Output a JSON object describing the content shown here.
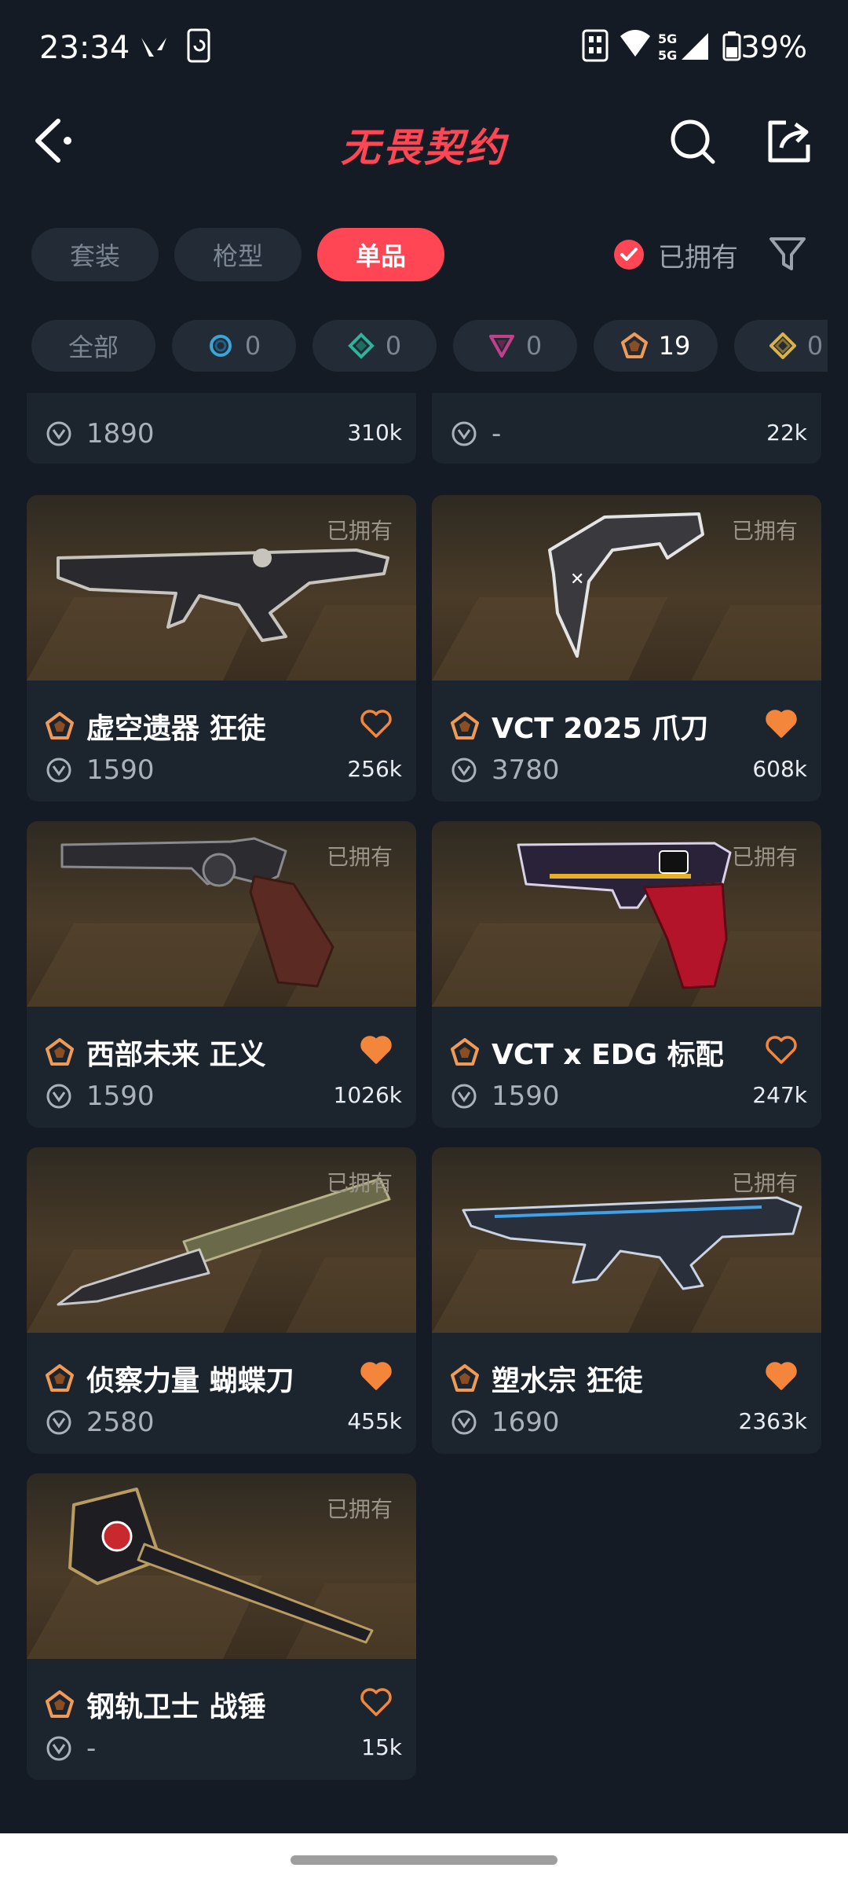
{
  "status_bar": {
    "time": "23:34",
    "network": "5G",
    "battery": "39%"
  },
  "header": {
    "title": "无畏契约"
  },
  "tabs": [
    {
      "label": "套装",
      "active": false
    },
    {
      "label": "枪型",
      "active": false
    },
    {
      "label": "单品",
      "active": true
    }
  ],
  "owned_filter": {
    "label": "已拥有",
    "checked": true
  },
  "rarity_chips": [
    {
      "label": "全部"
    },
    {
      "count": "0",
      "icon": "select-tier-icon",
      "color": "#3aa6d8"
    },
    {
      "count": "0",
      "icon": "deluxe-tier-icon",
      "color": "#2fb39a"
    },
    {
      "count": "0",
      "icon": "premium-tier-icon",
      "color": "#c0418a"
    },
    {
      "count": "19",
      "icon": "exclusive-tier-icon",
      "color": "#f09b55",
      "selected": true
    },
    {
      "count": "0",
      "icon": "ultra-tier-icon",
      "color": "#d9b24a"
    }
  ],
  "partial_cards": [
    {
      "price": "1890",
      "likes": "310k"
    },
    {
      "price": "-",
      "likes": "22k"
    }
  ],
  "cards": [
    {
      "name": "虚空遗器 狂徒",
      "price": "1590",
      "likes": "256k",
      "owned_label": "已拥有",
      "liked": false
    },
    {
      "name": "VCT 2025 爪刀",
      "price": "3780",
      "likes": "608k",
      "owned_label": "已拥有",
      "liked": true
    },
    {
      "name": "西部未来 正义",
      "price": "1590",
      "likes": "1026k",
      "owned_label": "已拥有",
      "liked": true
    },
    {
      "name": "VCT x EDG 标配",
      "price": "1590",
      "likes": "247k",
      "owned_label": "已拥有",
      "liked": false
    },
    {
      "name": "侦察力量 蝴蝶刀",
      "price": "2580",
      "likes": "455k",
      "owned_label": "已拥有",
      "liked": true
    },
    {
      "name": "塑水宗 狂徒",
      "price": "1690",
      "likes": "2363k",
      "owned_label": "已拥有",
      "liked": true
    },
    {
      "name": "钢轨卫士 战锤",
      "price": "-",
      "likes": "15k",
      "owned_label": "已拥有",
      "liked": false
    }
  ],
  "colors": {
    "accent": "#ff4655",
    "heart": "#f3863a",
    "rarity_exclusive": "#f09b55",
    "background": "#141b24",
    "card": "#1c242e"
  }
}
